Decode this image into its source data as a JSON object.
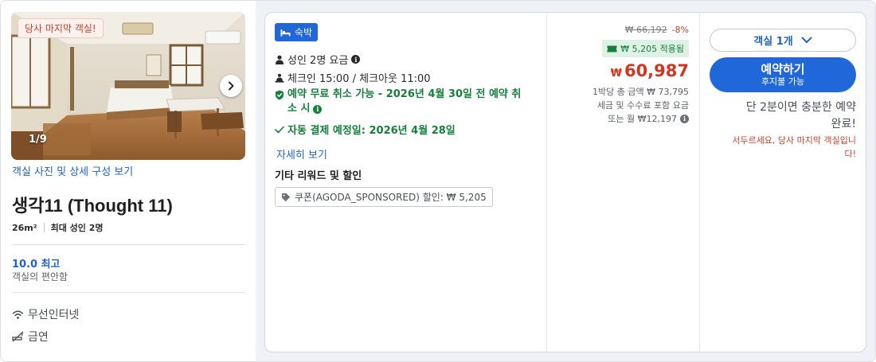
{
  "photo": {
    "badge": "당사 마지막 객실!",
    "counter": "1/9",
    "link": "객실 사진 및 상세 구성 보기"
  },
  "room": {
    "title": "생각11 (Thought 11)",
    "size": "26m²",
    "max_guests": "최대 성인 2명",
    "score": "10.0 최고",
    "score_label": "객실의 편안함",
    "amenities": [
      {
        "icon": "wifi-icon",
        "label": "무선인터넷"
      },
      {
        "icon": "no-smoking-icon",
        "label": "금연"
      }
    ]
  },
  "offer": {
    "tag": "숙박",
    "adults": "성인 2명 요금",
    "checkin": "체크인 15:00 / 체크아웃 11:00",
    "cancel_line1": "예약 무료 취소 가능 - 2026년 4월 30일 전 예약 취",
    "cancel_line2": "소 시",
    "autopay": "자동 결제 예정일: 2026년 4월 28일",
    "details_link": "자세히 보기",
    "other_title": "기타 리워드 및 할인",
    "coupon": "쿠폰(AGODA_SPONSORED) 할인: ₩ 5,205"
  },
  "price": {
    "old": "₩ 66,192",
    "discount_pct": "-8%",
    "applied": "₩ 5,205 적용됨",
    "currency": "₩",
    "current": "60,987",
    "per_night": "1박당 총 금액 ₩ 73,795",
    "tax_note": "세금 및 수수료 포함 요금",
    "monthly": "또는 월 ₩12,197"
  },
  "action": {
    "room_select": "객실 1개",
    "book_main": "예약하기",
    "book_sub": "후지불 가능",
    "hurry_line1": "단 2분이면 충분한 예약",
    "hurry_line2": "완료!",
    "urgency_line1": "서두르세요, 당사 마지막 객실입니",
    "urgency_line2": "다!"
  },
  "colors": {
    "accent_blue": "#2067d9",
    "link_blue": "#2164c6",
    "price_red": "#d2361f",
    "success_green": "#15803d"
  }
}
